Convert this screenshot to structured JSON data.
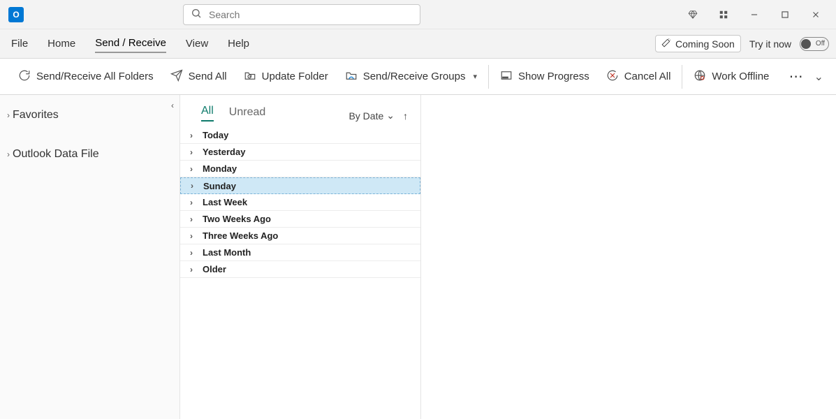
{
  "search": {
    "placeholder": "Search"
  },
  "titlebar": {
    "coming_soon_label": "Coming Soon",
    "try_it_label": "Try it now",
    "toggle_label": "Off"
  },
  "menu": {
    "file": "File",
    "home": "Home",
    "send_receive": "Send / Receive",
    "view": "View",
    "help": "Help"
  },
  "ribbon": {
    "send_receive_all": "Send/Receive All Folders",
    "send_all": "Send All",
    "update_folder": "Update Folder",
    "groups": "Send/Receive Groups",
    "show_progress": "Show Progress",
    "cancel_all": "Cancel All",
    "work_offline": "Work Offline"
  },
  "sidebar": {
    "favorites": "Favorites",
    "data_file": "Outlook Data File"
  },
  "maillist": {
    "tab_all": "All",
    "tab_unread": "Unread",
    "sort_by": "By Date",
    "groups": [
      {
        "label": "Today"
      },
      {
        "label": "Yesterday"
      },
      {
        "label": "Monday"
      },
      {
        "label": "Sunday",
        "selected": true
      },
      {
        "label": "Last Week"
      },
      {
        "label": "Two Weeks Ago"
      },
      {
        "label": "Three Weeks Ago"
      },
      {
        "label": "Last Month"
      },
      {
        "label": "Older"
      }
    ]
  }
}
